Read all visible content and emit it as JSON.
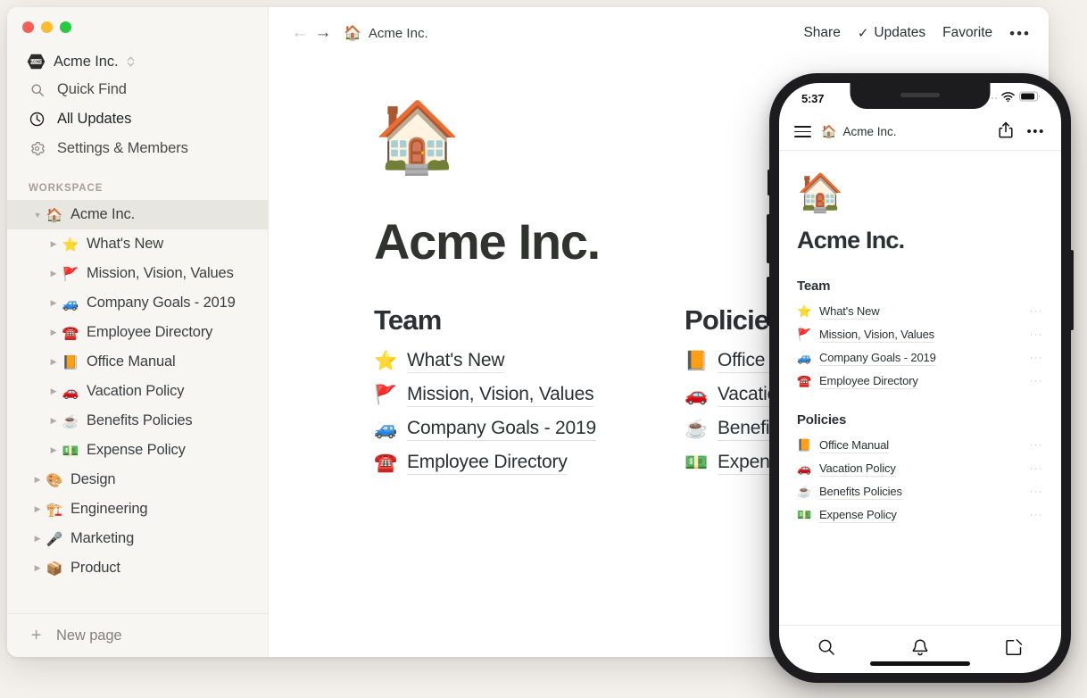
{
  "window": {
    "traffic_lights": [
      "close",
      "minimize",
      "zoom"
    ]
  },
  "sidebar": {
    "workspace_switcher": {
      "label": "Acme Inc.",
      "badge_text": "ACME"
    },
    "nav": [
      {
        "label": "Quick Find",
        "icon": "search-icon"
      },
      {
        "label": "All Updates",
        "icon": "clock-icon"
      },
      {
        "label": "Settings & Members",
        "icon": "gear-icon"
      }
    ],
    "section_label": "WORKSPACE",
    "tree": [
      {
        "label": "Acme Inc.",
        "emoji": "🏠",
        "level": 0,
        "selected": true,
        "expanded": true
      },
      {
        "label": "What's New",
        "emoji": "⭐",
        "level": 1,
        "selected": false,
        "expanded": false
      },
      {
        "label": "Mission, Vision, Values",
        "emoji": "🚩",
        "level": 1,
        "selected": false,
        "expanded": false
      },
      {
        "label": "Company Goals - 2019",
        "emoji": "🚙",
        "level": 1,
        "selected": false,
        "expanded": false
      },
      {
        "label": "Employee Directory",
        "emoji": "☎️",
        "level": 1,
        "selected": false,
        "expanded": false
      },
      {
        "label": "Office Manual",
        "emoji": "📙",
        "level": 1,
        "selected": false,
        "expanded": false
      },
      {
        "label": "Vacation Policy",
        "emoji": "🚗",
        "level": 1,
        "selected": false,
        "expanded": false
      },
      {
        "label": "Benefits Policies",
        "emoji": "☕",
        "level": 1,
        "selected": false,
        "expanded": false
      },
      {
        "label": "Expense Policy",
        "emoji": "💵",
        "level": 1,
        "selected": false,
        "expanded": false
      },
      {
        "label": "Design",
        "emoji": "🎨",
        "level": 0,
        "selected": false,
        "expanded": false
      },
      {
        "label": "Engineering",
        "emoji": "🏗️",
        "level": 0,
        "selected": false,
        "expanded": false
      },
      {
        "label": "Marketing",
        "emoji": "🎤",
        "level": 0,
        "selected": false,
        "expanded": false
      },
      {
        "label": "Product",
        "emoji": "📦",
        "level": 0,
        "selected": false,
        "expanded": false
      }
    ],
    "new_page_label": "New page"
  },
  "topbar": {
    "breadcrumb": {
      "emoji": "🏠",
      "label": "Acme Inc."
    },
    "share_label": "Share",
    "updates_label": "Updates",
    "updates_check": "✓",
    "favorite_label": "Favorite",
    "more_label": "•••"
  },
  "document": {
    "icon": "🏠",
    "title": "Acme Inc.",
    "columns": [
      {
        "heading": "Team",
        "links": [
          {
            "label": "What's New",
            "emoji": "⭐"
          },
          {
            "label": "Mission, Vision, Values",
            "emoji": "🚩"
          },
          {
            "label": "Company Goals - 2019",
            "emoji": "🚙"
          },
          {
            "label": "Employee Directory",
            "emoji": "☎️"
          }
        ]
      },
      {
        "heading": "Policies",
        "links": [
          {
            "label": "Office Manual",
            "emoji": "📙"
          },
          {
            "label": "Vacation Policy",
            "emoji": "🚗"
          },
          {
            "label": "Benefits Policies",
            "emoji": "☕"
          },
          {
            "label": "Expense Policy",
            "emoji": "💵"
          }
        ]
      }
    ]
  },
  "phone": {
    "status": {
      "time": "5:37",
      "wifi": "wifi-icon",
      "battery": "battery-icon"
    },
    "topbar": {
      "menu": "hamburger-icon",
      "breadcrumb": {
        "emoji": "🏠",
        "label": "Acme Inc."
      },
      "share": "share-icon",
      "more": "•••"
    },
    "document": {
      "icon": "🏠",
      "title": "Acme Inc.",
      "sections": [
        {
          "heading": "Team",
          "links": [
            {
              "label": "What's New",
              "emoji": "⭐",
              "more": "···"
            },
            {
              "label": "Mission, Vision, Values",
              "emoji": "🚩",
              "more": "···"
            },
            {
              "label": "Company Goals - 2019",
              "emoji": "🚙",
              "more": "···"
            },
            {
              "label": "Employee Directory",
              "emoji": "☎️",
              "more": "···"
            }
          ]
        },
        {
          "heading": "Policies",
          "links": [
            {
              "label": "Office Manual",
              "emoji": "📙",
              "more": "···"
            },
            {
              "label": "Vacation Policy",
              "emoji": "🚗",
              "more": "···"
            },
            {
              "label": "Benefits Policies",
              "emoji": "☕",
              "more": "···"
            },
            {
              "label": "Expense Policy",
              "emoji": "💵",
              "more": "···"
            }
          ]
        }
      ]
    },
    "tabs": [
      {
        "icon": "search-icon"
      },
      {
        "icon": "bell-icon"
      },
      {
        "icon": "compose-icon"
      }
    ]
  },
  "colors": {
    "page_background": "#f4f1ec",
    "sidebar_background": "#f7f6f3",
    "selected_row": "#e8e6e1",
    "text_primary": "#2c3033",
    "phone_frame": "#1c1c1e"
  }
}
